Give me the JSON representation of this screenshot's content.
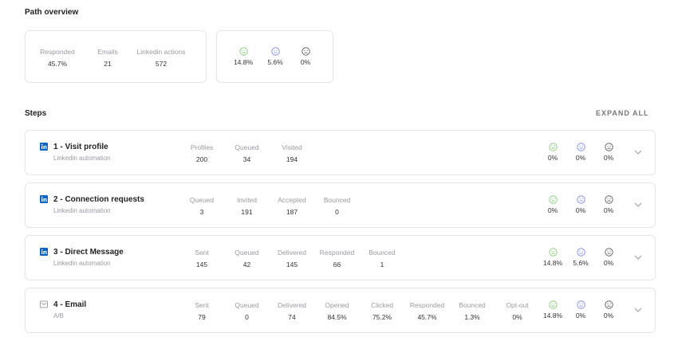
{
  "overview": {
    "title": "Path overview",
    "stats": [
      {
        "label": "Responded",
        "value": "45.7%"
      },
      {
        "label": "Emails",
        "value": "21"
      },
      {
        "label": "Linkedin actions",
        "value": "572"
      }
    ],
    "sentiment": [
      "14.8%",
      "5.6%",
      "0%"
    ]
  },
  "steps_title": "Steps",
  "expand_all": "EXPAND ALL",
  "colors": {
    "positive": "#7ccf6a",
    "neutral": "#7b86e6",
    "negative": "#555555",
    "linkedin": "#0a66c2"
  },
  "steps": [
    {
      "title": "1 - Visit profile",
      "subtitle": "Linkedin automation",
      "icon": "linkedin-icon",
      "stats": [
        {
          "label": "Profiles",
          "value": "200"
        },
        {
          "label": "Queued",
          "value": "34"
        },
        {
          "label": "Visited",
          "value": "194"
        }
      ],
      "sentiment": [
        "0%",
        "0%",
        "0%"
      ]
    },
    {
      "title": "2 - Connection requests",
      "subtitle": "Linkedin automation",
      "icon": "linkedin-icon",
      "stats": [
        {
          "label": "Queued",
          "value": "3"
        },
        {
          "label": "Invited",
          "value": "191"
        },
        {
          "label": "Accepted",
          "value": "187"
        },
        {
          "label": "Bounced",
          "value": "0"
        }
      ],
      "sentiment": [
        "0%",
        "0%",
        "0%"
      ]
    },
    {
      "title": "3 - Direct Message",
      "subtitle": "Linkedin automation",
      "icon": "linkedin-icon",
      "stats": [
        {
          "label": "Sent",
          "value": "145"
        },
        {
          "label": "Queued",
          "value": "42"
        },
        {
          "label": "Delivered",
          "value": "145"
        },
        {
          "label": "Responded",
          "value": "66"
        },
        {
          "label": "Bounced",
          "value": "1"
        }
      ],
      "sentiment": [
        "14.8%",
        "5.6%",
        "0%"
      ]
    },
    {
      "title": "4 - Email",
      "subtitle": "A/B",
      "icon": "mail-icon",
      "stats": [
        {
          "label": "Sent",
          "value": "79"
        },
        {
          "label": "Queued",
          "value": "0"
        },
        {
          "label": "Delivered",
          "value": "74"
        },
        {
          "label": "Opened",
          "value": "84.5%"
        },
        {
          "label": "Clicked",
          "value": "75.2%"
        },
        {
          "label": "Responded",
          "value": "45.7%"
        },
        {
          "label": "Bounced",
          "value": "1.3%"
        },
        {
          "label": "Opt-out",
          "value": "0%"
        }
      ],
      "sentiment": [
        "14.8%",
        "0%",
        "0%"
      ]
    }
  ]
}
